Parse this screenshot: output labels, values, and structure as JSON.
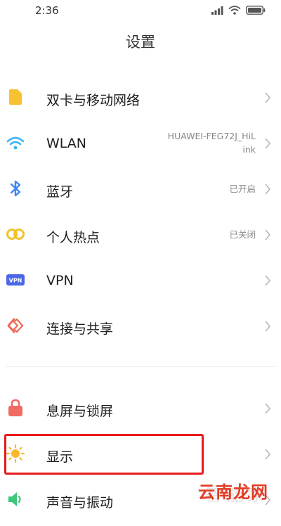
{
  "status": {
    "time": "2:36"
  },
  "title": "设置",
  "items": [
    {
      "label": "双卡与移动网络",
      "value": "",
      "icon": "sim-card-icon",
      "color": "#f7c12f"
    },
    {
      "label": "WLAN",
      "value_line1": "HUAWEI-FEG72J_HiL",
      "value_line2": "ink",
      "icon": "wifi-icon",
      "color": "#3eb6f0"
    },
    {
      "label": "蓝牙",
      "value": "已开启",
      "icon": "bluetooth-icon",
      "color": "#3a86f5"
    },
    {
      "label": "个人热点",
      "value": "已关闭",
      "icon": "hotspot-icon",
      "color": "#f2c22c"
    },
    {
      "label": "VPN",
      "value": "",
      "icon": "vpn-icon",
      "color": "#4b67e8"
    },
    {
      "label": "连接与共享",
      "value": "",
      "icon": "share-icon",
      "color": "#ee6b57"
    },
    {
      "label": "息屏与锁屏",
      "value": "",
      "icon": "lock-icon",
      "color": "#f06b62"
    },
    {
      "label": "显示",
      "value": "",
      "icon": "brightness-icon",
      "color": "#f8b92d"
    },
    {
      "label": "声音与振动",
      "value": "",
      "icon": "speaker-icon",
      "color": "#3cc77a"
    }
  ],
  "vpn_badge": "VPN",
  "watermark": {
    "main": "云南龙网",
    "faint": "智能家"
  }
}
